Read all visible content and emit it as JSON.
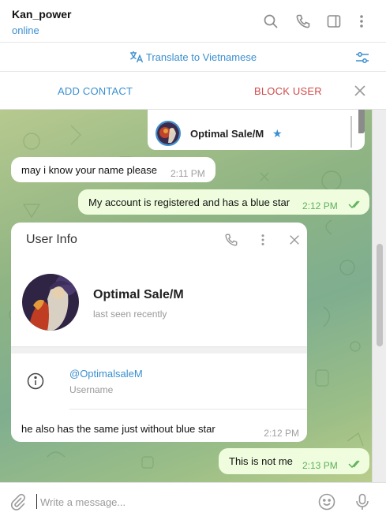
{
  "header": {
    "title": "Kan_power",
    "status": "online",
    "icons": [
      "search-icon",
      "phone-icon",
      "sidebar-icon",
      "more-icon"
    ]
  },
  "translate_bar": {
    "label": "Translate to Vietnamese"
  },
  "action_bar": {
    "add_contact": "ADD CONTACT",
    "block_user": "BLOCK USER"
  },
  "pinned": {
    "name": "Optimal Sale/M",
    "star": "★"
  },
  "messages": [
    {
      "direction": "in",
      "text": "may i know your name please",
      "time": "2:11 PM"
    },
    {
      "direction": "out",
      "text": "My account is registered and has a blue star",
      "time": "2:12 PM"
    },
    {
      "direction": "in",
      "text": "he also has the same just without blue star",
      "time": "2:12 PM"
    },
    {
      "direction": "out",
      "text": "This is not me",
      "time": "2:13 PM"
    }
  ],
  "user_info": {
    "title": "User Info",
    "name": "Optimal Sale/M",
    "last_seen": "last seen recently",
    "username": "@OptimalsaleM",
    "username_label": "Username"
  },
  "composer": {
    "placeholder": "Write a message..."
  },
  "colors": {
    "accent": "#3a8fd0",
    "danger": "#d14949",
    "outgoing_bubble": "#effdde",
    "read_ticks": "#5fb05a"
  }
}
